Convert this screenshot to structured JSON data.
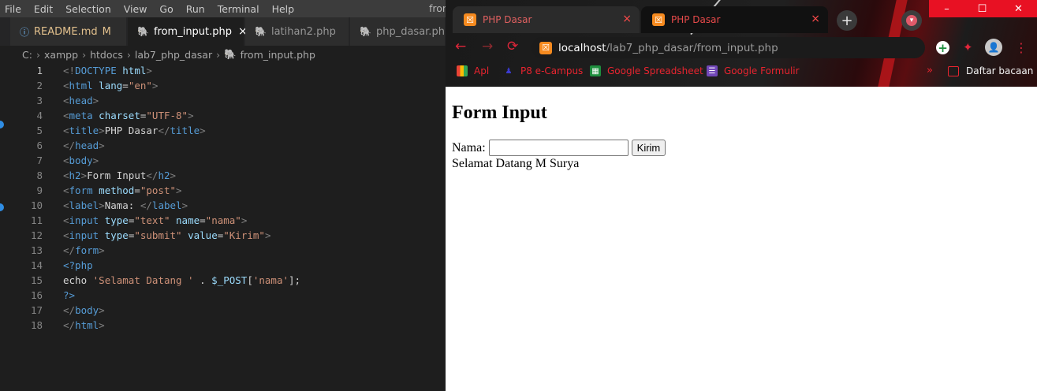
{
  "vscode": {
    "menu": [
      "File",
      "Edit",
      "Selection",
      "View",
      "Go",
      "Run",
      "Terminal",
      "Help"
    ],
    "window_title_fragment": "fron",
    "tabs": [
      {
        "label": "README.md",
        "badge": "M",
        "icon": "info-icon"
      },
      {
        "label": "from_input.php",
        "close": "×",
        "icon": "php-icon"
      },
      {
        "label": "latihan2.php",
        "icon": "php-icon"
      },
      {
        "label": "php_dasar.php",
        "icon": "php-icon"
      }
    ],
    "breadcrumb": [
      "C:",
      "xampp",
      "htdocs",
      "lab7_php_dasar",
      "from_input.php"
    ],
    "line_numbers": [
      "1",
      "2",
      "3",
      "4",
      "5",
      "6",
      "7",
      "8",
      "9",
      "10",
      "11",
      "12",
      "13",
      "14",
      "15",
      "16",
      "17",
      "18"
    ],
    "code": {
      "l1_open": "<!",
      "l1_name": "DOCTYPE",
      "l1_attr": " html",
      "l1_close": ">",
      "l2_open": "<",
      "l2_name": "html",
      "l2_attr": " lang",
      "l2_eq": "=",
      "l2_str": "\"en\"",
      "l2_close": ">",
      "l3_open": "<",
      "l3_name": "head",
      "l3_close": ">",
      "l4_open": "<",
      "l4_name": "meta",
      "l4_attr": " charset",
      "l4_eq": "=",
      "l4_str": "\"UTF-8\"",
      "l4_close": ">",
      "l5_open": "<",
      "l5_name": "title",
      "l5_close": ">",
      "l5_text": "PHP Dasar",
      "l5_end_open": "</",
      "l5_end_name": "title",
      "l5_end_close": ">",
      "l6_open": "</",
      "l6_name": "head",
      "l6_close": ">",
      "l7_open": "<",
      "l7_name": "body",
      "l7_close": ">",
      "l8_open": "<",
      "l8_name": "h2",
      "l8_close": ">",
      "l8_text": "Form Input",
      "l8_end_open": "</",
      "l8_end_name": "h2",
      "l8_end_close": ">",
      "l9_open": "<",
      "l9_name": "form",
      "l9_attr": " method",
      "l9_eq": "=",
      "l9_str": "\"post\"",
      "l9_close": ">",
      "l10_open": "<",
      "l10_name": "label",
      "l10_close": ">",
      "l10_text": "Nama: ",
      "l10_end_open": "</",
      "l10_end_name": "label",
      "l10_end_close": ">",
      "l11_open": "<",
      "l11_name": "input",
      "l11_attr1": " type",
      "l11_eq1": "=",
      "l11_str1": "\"text\"",
      "l11_attr2": " name",
      "l11_eq2": "=",
      "l11_str2": "\"nama\"",
      "l11_close": ">",
      "l12_open": "<",
      "l12_name": "input",
      "l12_attr1": " type",
      "l12_eq1": "=",
      "l12_str1": "\"submit\"",
      "l12_attr2": " value",
      "l12_eq2": "=",
      "l12_str2": "\"Kirim\"",
      "l12_close": ">",
      "l13_open": "</",
      "l13_name": "form",
      "l13_close": ">",
      "l14_php": "<?php",
      "l15_echo": "echo ",
      "l15_str": "'Selamat Datang '",
      "l15_dot": " . ",
      "l15_var": "$_POST",
      "l15_br1": "[",
      "l15_key": "'nama'",
      "l15_br2": "];",
      "l16_php": "?>",
      "l17_open": "</",
      "l17_name": "body",
      "l17_close": ">",
      "l18_open": "</",
      "l18_name": "html",
      "l18_close": ">"
    }
  },
  "chrome": {
    "tabs": [
      {
        "title": "PHP Dasar",
        "favicon": "xampp-icon",
        "close": "×"
      },
      {
        "title": "PHP Dasar",
        "favicon": "xampp-icon",
        "close": "×"
      }
    ],
    "new_tab": "+",
    "window_buttons": {
      "minimize": "–",
      "maximize": "☐",
      "close": "✕"
    },
    "nav": {
      "back": "←",
      "forward": "→",
      "reload": "⟳"
    },
    "address": {
      "host": "localhost",
      "path": "/lab7_php_dasar/from_input.php"
    },
    "toolbar_icons": {
      "add": "+",
      "extensions": "✦",
      "avatar": "👤",
      "menu": "⋮"
    },
    "bookmarks": [
      {
        "label": "Apl",
        "icon": "apps-grid-icon"
      },
      {
        "label": "P8 e-Campus",
        "icon": "campus-icon"
      },
      {
        "label": "Google Spreadsheet",
        "icon": "sheets-icon"
      },
      {
        "label": "Google Formulir",
        "icon": "forms-icon"
      }
    ],
    "bookmarks_more": "»",
    "reading_list": "Daftar bacaan",
    "accent": "#e8242f"
  },
  "page": {
    "heading": "Form Input",
    "label": "Nama:",
    "input_value": "",
    "submit_label": "Kirim",
    "output": "Selamat Datang M Surya"
  }
}
